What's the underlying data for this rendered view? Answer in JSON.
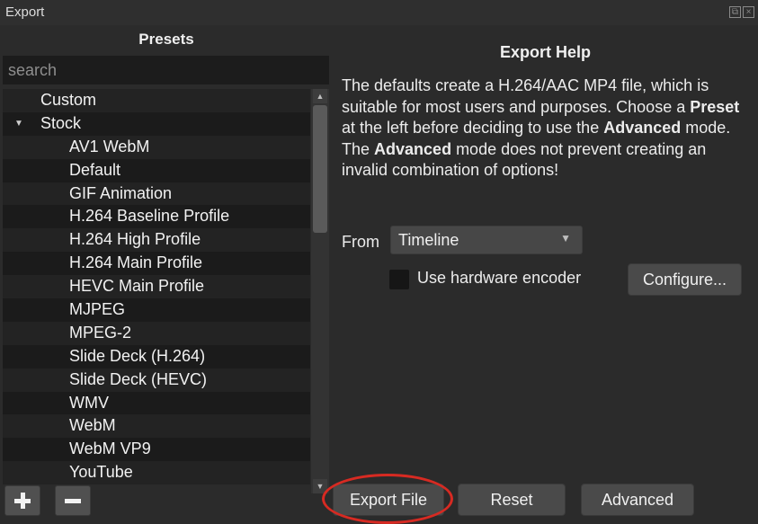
{
  "window": {
    "title": "Export"
  },
  "presets": {
    "header": "Presets",
    "search_placeholder": "search",
    "tree": [
      {
        "label": "Custom",
        "level": 0
      },
      {
        "label": "Stock",
        "level": 0,
        "expanded": true
      },
      {
        "label": "AV1 WebM",
        "level": 1
      },
      {
        "label": "Default",
        "level": 1
      },
      {
        "label": "GIF Animation",
        "level": 1
      },
      {
        "label": "H.264 Baseline Profile",
        "level": 1
      },
      {
        "label": "H.264 High Profile",
        "level": 1
      },
      {
        "label": "H.264 Main Profile",
        "level": 1
      },
      {
        "label": "HEVC Main Profile",
        "level": 1
      },
      {
        "label": "MJPEG",
        "level": 1
      },
      {
        "label": "MPEG-2",
        "level": 1
      },
      {
        "label": "Slide Deck (H.264)",
        "level": 1
      },
      {
        "label": "Slide Deck (HEVC)",
        "level": 1
      },
      {
        "label": "WMV",
        "level": 1
      },
      {
        "label": "WebM",
        "level": 1
      },
      {
        "label": "WebM VP9",
        "level": 1
      },
      {
        "label": "YouTube",
        "level": 1
      }
    ],
    "add_icon": "plus-icon",
    "remove_icon": "minus-icon"
  },
  "help": {
    "title": "Export Help",
    "text_parts": [
      {
        "text": "The defaults create a H.264/AAC MP4 file, which is suitable for most users and purposes. Choose a ",
        "bold": false
      },
      {
        "text": "Preset",
        "bold": true
      },
      {
        "text": " at the left before deciding to use the ",
        "bold": false
      },
      {
        "text": "Advanced",
        "bold": true
      },
      {
        "text": " mode. The ",
        "bold": false
      },
      {
        "text": "Advanced",
        "bold": true
      },
      {
        "text": " mode does not prevent creating an invalid combination of options!",
        "bold": false
      }
    ]
  },
  "from": {
    "label": "From",
    "value": "Timeline"
  },
  "hardware": {
    "label": "Use hardware encoder",
    "checked": false,
    "configure_label": "Configure..."
  },
  "actions": {
    "export_label": "Export File",
    "reset_label": "Reset",
    "advanced_label": "Advanced"
  },
  "colors": {
    "highlight": "#d72a22",
    "background": "#2b2b2b"
  }
}
